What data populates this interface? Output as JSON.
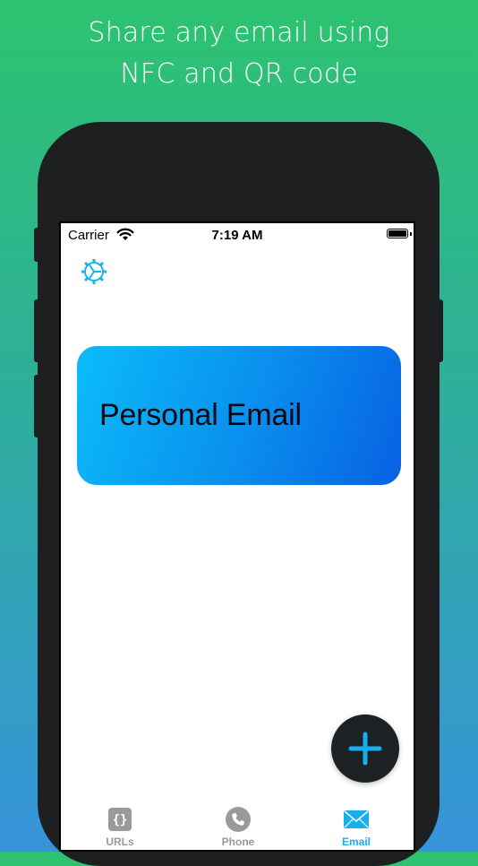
{
  "headline": {
    "line1": "Share any email using",
    "line2": "NFC and QR code"
  },
  "status_bar": {
    "carrier": "Carrier",
    "time": "7:19 AM"
  },
  "card": {
    "title": "Personal Email"
  },
  "tabs": [
    {
      "label": "URLs",
      "icon": "curly-braces-icon",
      "active": false
    },
    {
      "label": "Phone",
      "icon": "phone-icon",
      "active": false
    },
    {
      "label": "Email",
      "icon": "envelope-icon",
      "active": true
    }
  ],
  "colors": {
    "accent": "#17aef0",
    "card_gradient_start": "#0bbcfa",
    "card_gradient_end": "#0761e2",
    "fab_background": "#1c2124",
    "background_top": "#2dc36f",
    "background_bottom": "#3693dc"
  }
}
